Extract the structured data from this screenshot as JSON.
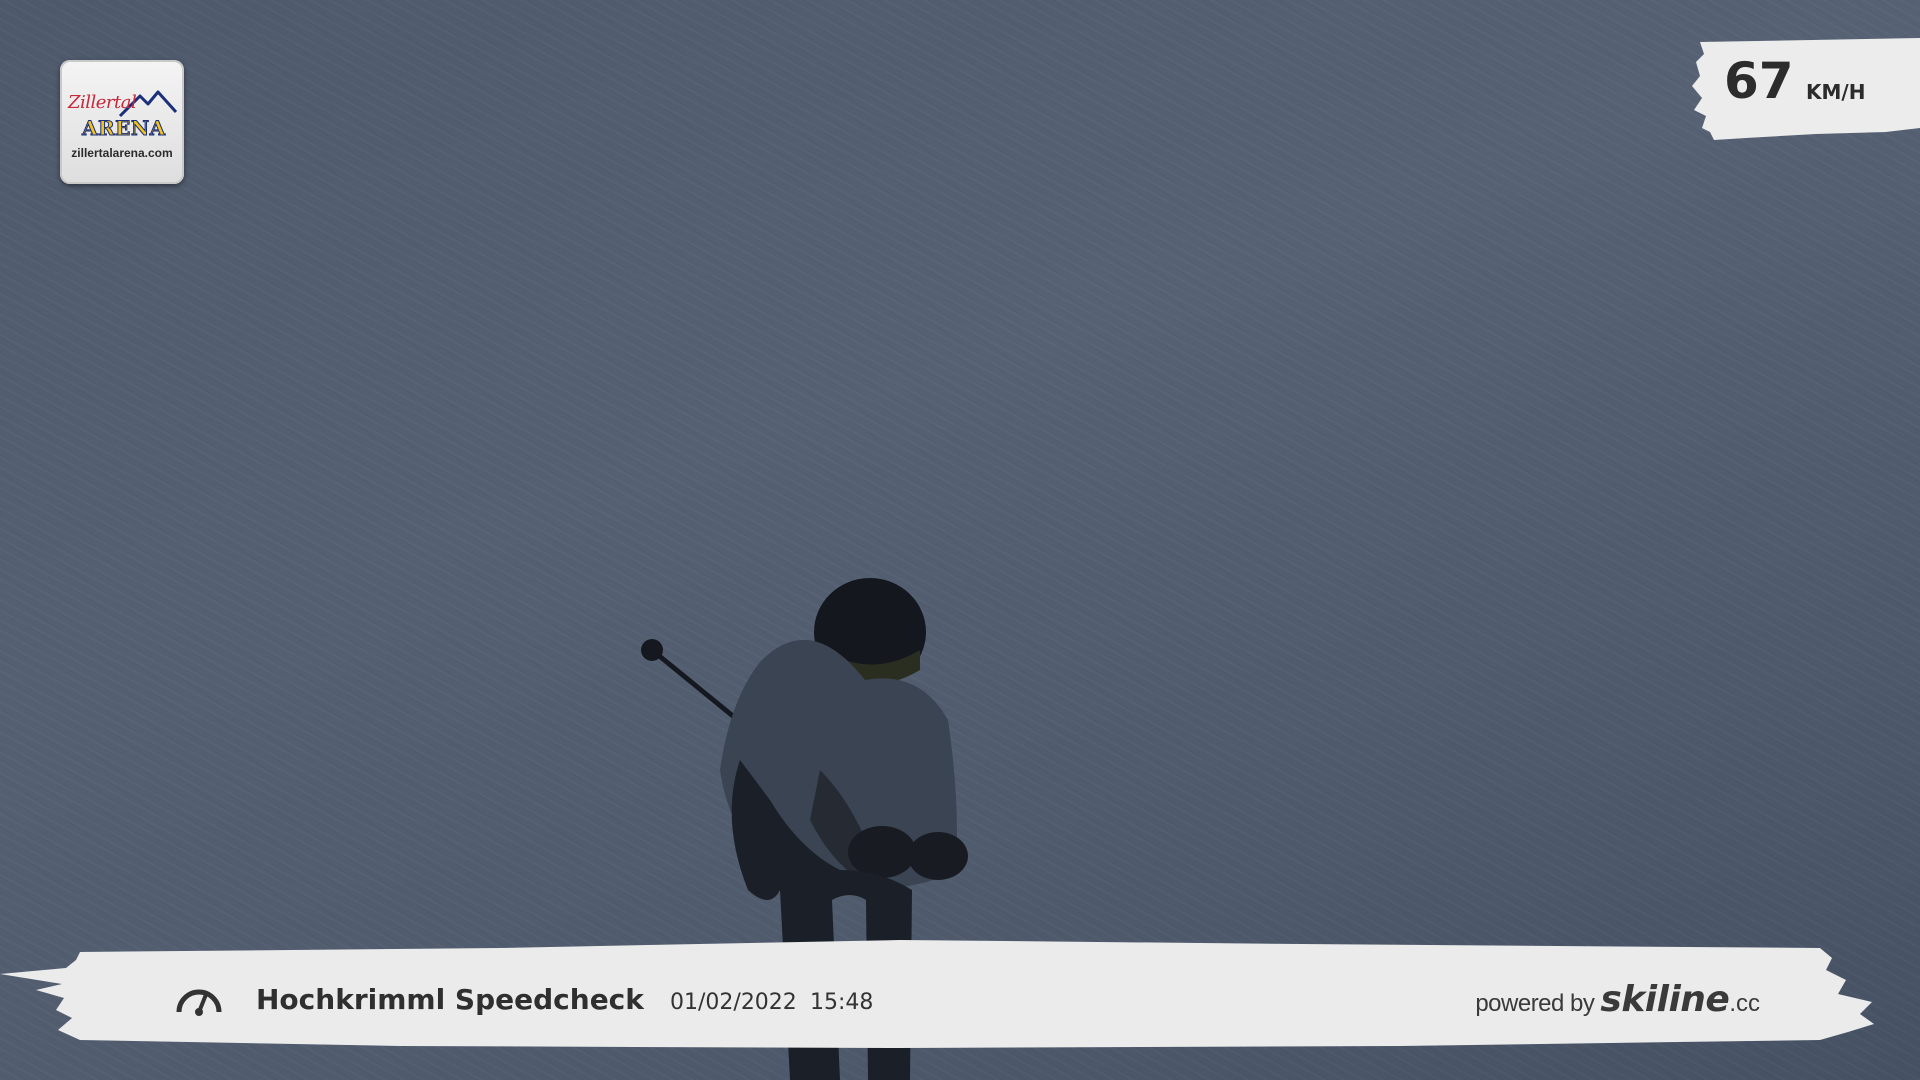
{
  "logo": {
    "script_text": "Zillertal",
    "arena_text": "ARENA",
    "url_text": "zillertalarena.com"
  },
  "speed": {
    "value": "67",
    "unit": "KM/H"
  },
  "banner": {
    "icon": "speedometer-icon",
    "title": "Hochkrimml Speedcheck",
    "date": "01/02/2022",
    "time": "15:48",
    "powered_by": "powered by",
    "brand": "skiline",
    "brand_tld": ".cc"
  },
  "colors": {
    "background": "#4e5a6c",
    "banner": "#ebebeb",
    "text_dark": "#2f2f2f",
    "logo_red": "#c8283a",
    "logo_yellow": "#f2c31a",
    "logo_blue": "#1b2f7a"
  }
}
